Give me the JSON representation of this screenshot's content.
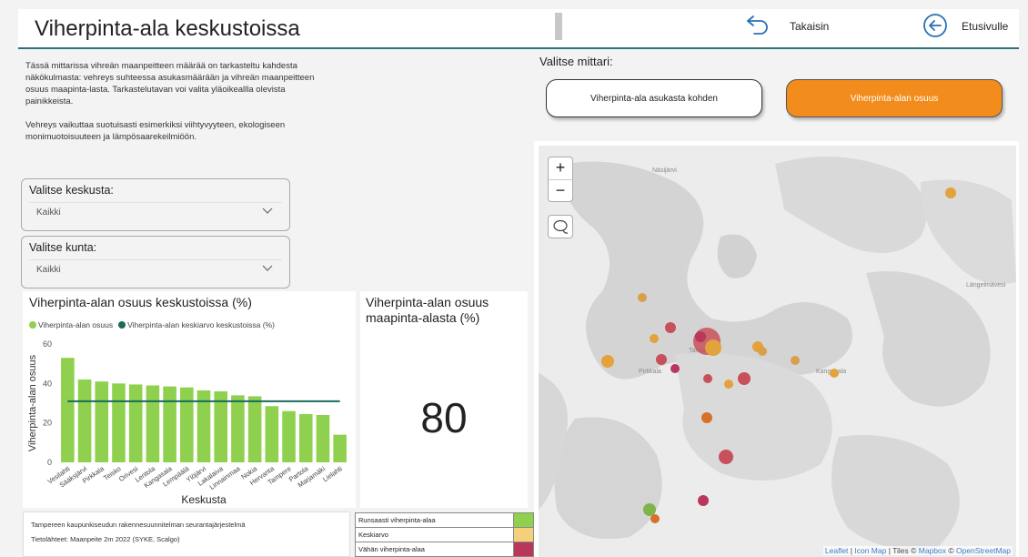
{
  "header": {
    "title": "Viherpinta-ala keskustoissa",
    "back_label": "Takaisin",
    "home_label": "Etusivulle"
  },
  "intro": {
    "paragraph1": "Tässä mittarissa vihreän maanpeitteen määrää on tarkasteltu kahdesta näkökulmasta: vehreys suhteessa asukasmäärään ja vihreän maanpeitteen osuus maapinta-lasta. Tarkastelutavan voi valita yläoikeallla olevista painikkeista.",
    "paragraph2": "Vehreys vaikuttaa suotuisasti esimerkiksi viihtyvyyteen, ekologiseen monimuotoisuuteen ja lämpösaarekeilmiöön."
  },
  "filters": {
    "center_label": "Valitse keskusta:",
    "center_value": "Kaikki",
    "municipality_label": "Valitse kunta:",
    "municipality_value": "Kaikki"
  },
  "selector": {
    "title": "Valitse mittari:",
    "button1": "Viherpinta-ala asukasta kohden",
    "button2": "Viherpinta-alan osuus"
  },
  "kpi": {
    "title": "Viherpinta-alan osuus maapinta-alasta (%)",
    "value": "80"
  },
  "footnote": {
    "line1": "Tampereen kaupunkiseudun rakennesuunnitelman seurantajärjestelmä",
    "line2": "Tietolähteet: Maanpeite 2m 2022 (SYKE, Scalgo)"
  },
  "legend_table": [
    {
      "label": "Runsaasti viherpinta-alaa",
      "color": "#8fd14f"
    },
    {
      "label": "Keskiarvo",
      "color": "#f5d07a"
    },
    {
      "label": "Vähän viherpinta-alaa",
      "color": "#b8375a"
    }
  ],
  "map": {
    "attrib_leaflet": "Leaflet",
    "attrib_sep1": " | ",
    "attrib_iconmap": "Icon Map",
    "attrib_tiles": " | Tiles © ",
    "attrib_mapbox": "Mapbox",
    "attrib_copy": " © ",
    "attrib_osm": "OpenStreetMap",
    "labels": {
      "nasijarvi": "Näsijärvi",
      "tampere": "Tampere",
      "pirkkala": "Pirkkala",
      "kangasala": "Kangasala",
      "langelmavesi": "Längelmävesi"
    }
  },
  "chart_data": {
    "type": "bar",
    "title": "Viherpinta-alan osuus keskustoissa (%)",
    "xlabel": "Keskusta",
    "ylabel": "Viherpinta-alan osuus",
    "ylim": [
      0,
      60
    ],
    "yticks": [
      0,
      20,
      40,
      60
    ],
    "categories": [
      "Vesilahti",
      "Sääksjärvi",
      "Pirkkala",
      "Teisko",
      "Orivesi",
      "Lentola",
      "Kangasala",
      "Lempäälä",
      "Ylöjärvi",
      "Lakalaiva",
      "Linnainmaa",
      "Nokia",
      "Hervanta",
      "Tampere",
      "Partola",
      "Marjamäki",
      "Lielahti"
    ],
    "series": [
      {
        "name": "Viherpinta-alan osuus",
        "color": "#8fd14f",
        "values": [
          53,
          42,
          41,
          40,
          39.5,
          39,
          38.5,
          38,
          36.5,
          36,
          34,
          33.5,
          28.5,
          26,
          24.5,
          24,
          14
        ]
      },
      {
        "name": "Viherpinta-alan keskiarvo keskustoissa (%)",
        "color": "#1a6b5a",
        "values": [
          31,
          31,
          31,
          31,
          31,
          31,
          31,
          31,
          31,
          31,
          31,
          31,
          31,
          31,
          31,
          31,
          31
        ]
      }
    ],
    "legend_position": "top-left"
  }
}
